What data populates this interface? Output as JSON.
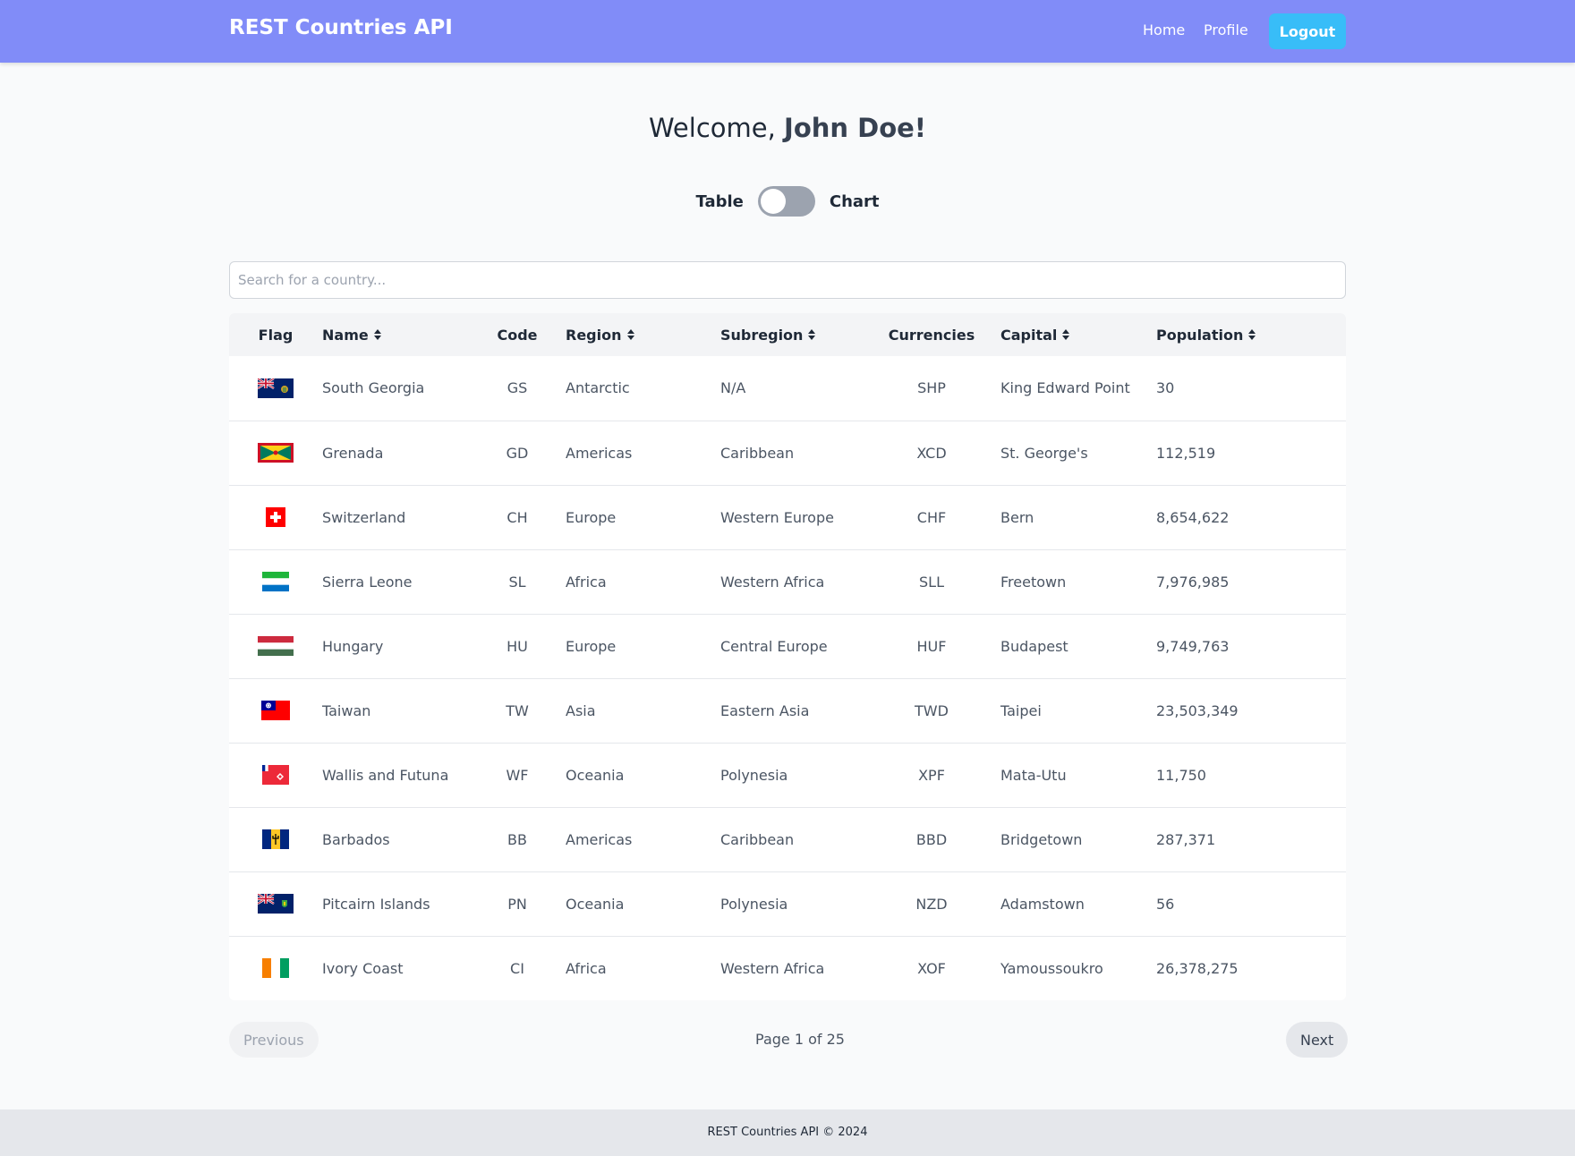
{
  "navbar": {
    "brand": "REST Countries API",
    "links": {
      "home": "Home",
      "profile": "Profile"
    },
    "logout_label": "Logout"
  },
  "welcome": {
    "prefix": "Welcome, ",
    "user": "John Doe!"
  },
  "view_toggle": {
    "left_label": "Table",
    "right_label": "Chart",
    "selected": "Table"
  },
  "search": {
    "placeholder": "Search for a country...",
    "value": ""
  },
  "table": {
    "headers": {
      "flag": "Flag",
      "name": "Name",
      "code": "Code",
      "region": "Region",
      "subregion": "Subregion",
      "currencies": "Currencies",
      "capital": "Capital",
      "population": "Population"
    },
    "rows": [
      {
        "flag": "south-georgia-flag-icon",
        "name": "South Georgia",
        "code": "GS",
        "region": "Antarctic",
        "subregion": "N/A",
        "currencies": "SHP",
        "capital": "King Edward Point",
        "population": "30"
      },
      {
        "flag": "grenada-flag-icon",
        "name": "Grenada",
        "code": "GD",
        "region": "Americas",
        "subregion": "Caribbean",
        "currencies": "XCD",
        "capital": "St. George's",
        "population": "112,519"
      },
      {
        "flag": "switzerland-flag-icon",
        "name": "Switzerland",
        "code": "CH",
        "region": "Europe",
        "subregion": "Western Europe",
        "currencies": "CHF",
        "capital": "Bern",
        "population": "8,654,622"
      },
      {
        "flag": "sierra-leone-flag-icon",
        "name": "Sierra Leone",
        "code": "SL",
        "region": "Africa",
        "subregion": "Western Africa",
        "currencies": "SLL",
        "capital": "Freetown",
        "population": "7,976,985"
      },
      {
        "flag": "hungary-flag-icon",
        "name": "Hungary",
        "code": "HU",
        "region": "Europe",
        "subregion": "Central Europe",
        "currencies": "HUF",
        "capital": "Budapest",
        "population": "9,749,763"
      },
      {
        "flag": "taiwan-flag-icon",
        "name": "Taiwan",
        "code": "TW",
        "region": "Asia",
        "subregion": "Eastern Asia",
        "currencies": "TWD",
        "capital": "Taipei",
        "population": "23,503,349"
      },
      {
        "flag": "wallis-futuna-flag-icon",
        "name": "Wallis and Futuna",
        "code": "WF",
        "region": "Oceania",
        "subregion": "Polynesia",
        "currencies": "XPF",
        "capital": "Mata-Utu",
        "population": "11,750"
      },
      {
        "flag": "barbados-flag-icon",
        "name": "Barbados",
        "code": "BB",
        "region": "Americas",
        "subregion": "Caribbean",
        "currencies": "BBD",
        "capital": "Bridgetown",
        "population": "287,371"
      },
      {
        "flag": "pitcairn-flag-icon",
        "name": "Pitcairn Islands",
        "code": "PN",
        "region": "Oceania",
        "subregion": "Polynesia",
        "currencies": "NZD",
        "capital": "Adamstown",
        "population": "56"
      },
      {
        "flag": "ivory-coast-flag-icon",
        "name": "Ivory Coast",
        "code": "CI",
        "region": "Africa",
        "subregion": "Western Africa",
        "currencies": "XOF",
        "capital": "Yamoussoukro",
        "population": "26,378,275"
      }
    ]
  },
  "pagination": {
    "previous": "Previous",
    "next": "Next",
    "info": "Page 1 of 25"
  },
  "footer": {
    "text": "REST Countries API © 2024"
  },
  "colors": {
    "navbar": "#818cf8",
    "logout": "#38bdf8",
    "toggle_off": "#9ca3af"
  }
}
